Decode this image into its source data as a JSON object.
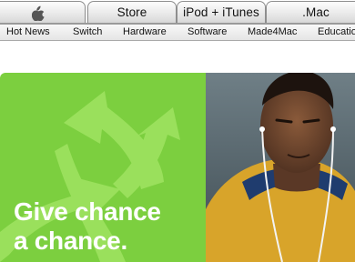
{
  "tabs": [
    {
      "id": "apple",
      "label": "",
      "icon": "apple-logo-icon"
    },
    {
      "id": "store",
      "label": "Store"
    },
    {
      "id": "ipod",
      "label": "iPod + iTunes"
    },
    {
      "id": "mac",
      "label": ".Mac"
    }
  ],
  "subnav": [
    "Hot News",
    "Switch",
    "Hardware",
    "Software",
    "Made4Mac",
    "Education"
  ],
  "hero": {
    "headline_line1": "Give chance",
    "headline_line2": "a chance.",
    "accent_color": "#7ccf3f",
    "arrow_color": "#9ae05c",
    "photo_icon": "man-with-earbuds-photo"
  }
}
